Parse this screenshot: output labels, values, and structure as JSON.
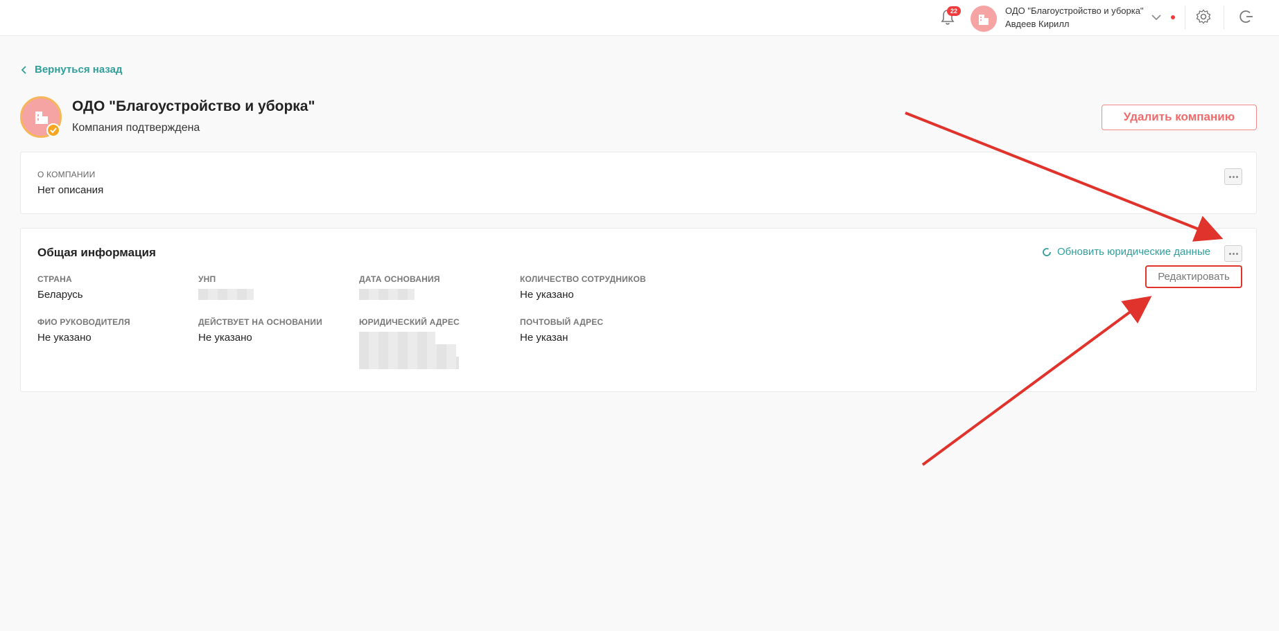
{
  "header": {
    "notifications_count": "22",
    "user_company": "ОДО \"Благоустройство и уборка\"",
    "user_name": "Авдеев Кирилл",
    "icons": [
      "bell-icon",
      "building-icon",
      "chevron-down-icon",
      "gear-icon",
      "logout-icon"
    ]
  },
  "page": {
    "back_label": "Вернуться назад",
    "company_name": "ОДО \"Благоустройство и уборка\"",
    "company_status": "Компания подтверждена",
    "delete_label": "Удалить компанию"
  },
  "about": {
    "label": "О компании",
    "value": "Нет описания"
  },
  "general": {
    "title": "Общая информация",
    "refresh_label": "Обновить юридические данные",
    "edit_label": "Редактировать",
    "fields": {
      "country": {
        "label": "Страна",
        "value": "Беларусь"
      },
      "unp": {
        "label": "УНП"
      },
      "founded": {
        "label": "Дата основания"
      },
      "employees": {
        "label": "Количество сотрудников",
        "value": "Не указано"
      },
      "director": {
        "label": "ФИО руководителя",
        "value": "Не указано"
      },
      "basis": {
        "label": "Действует на основании",
        "value": "Не указано"
      },
      "legal_address": {
        "label": "Юридический адрес"
      },
      "postal_address": {
        "label": "Почтовый адрес",
        "value": "Не указан"
      }
    }
  },
  "colors": {
    "accent": "#2f9e9a",
    "danger": "#ef6b6b",
    "annotation": "#e0332b",
    "avatar": "#f5a3a3",
    "verified": "#f6a623"
  }
}
